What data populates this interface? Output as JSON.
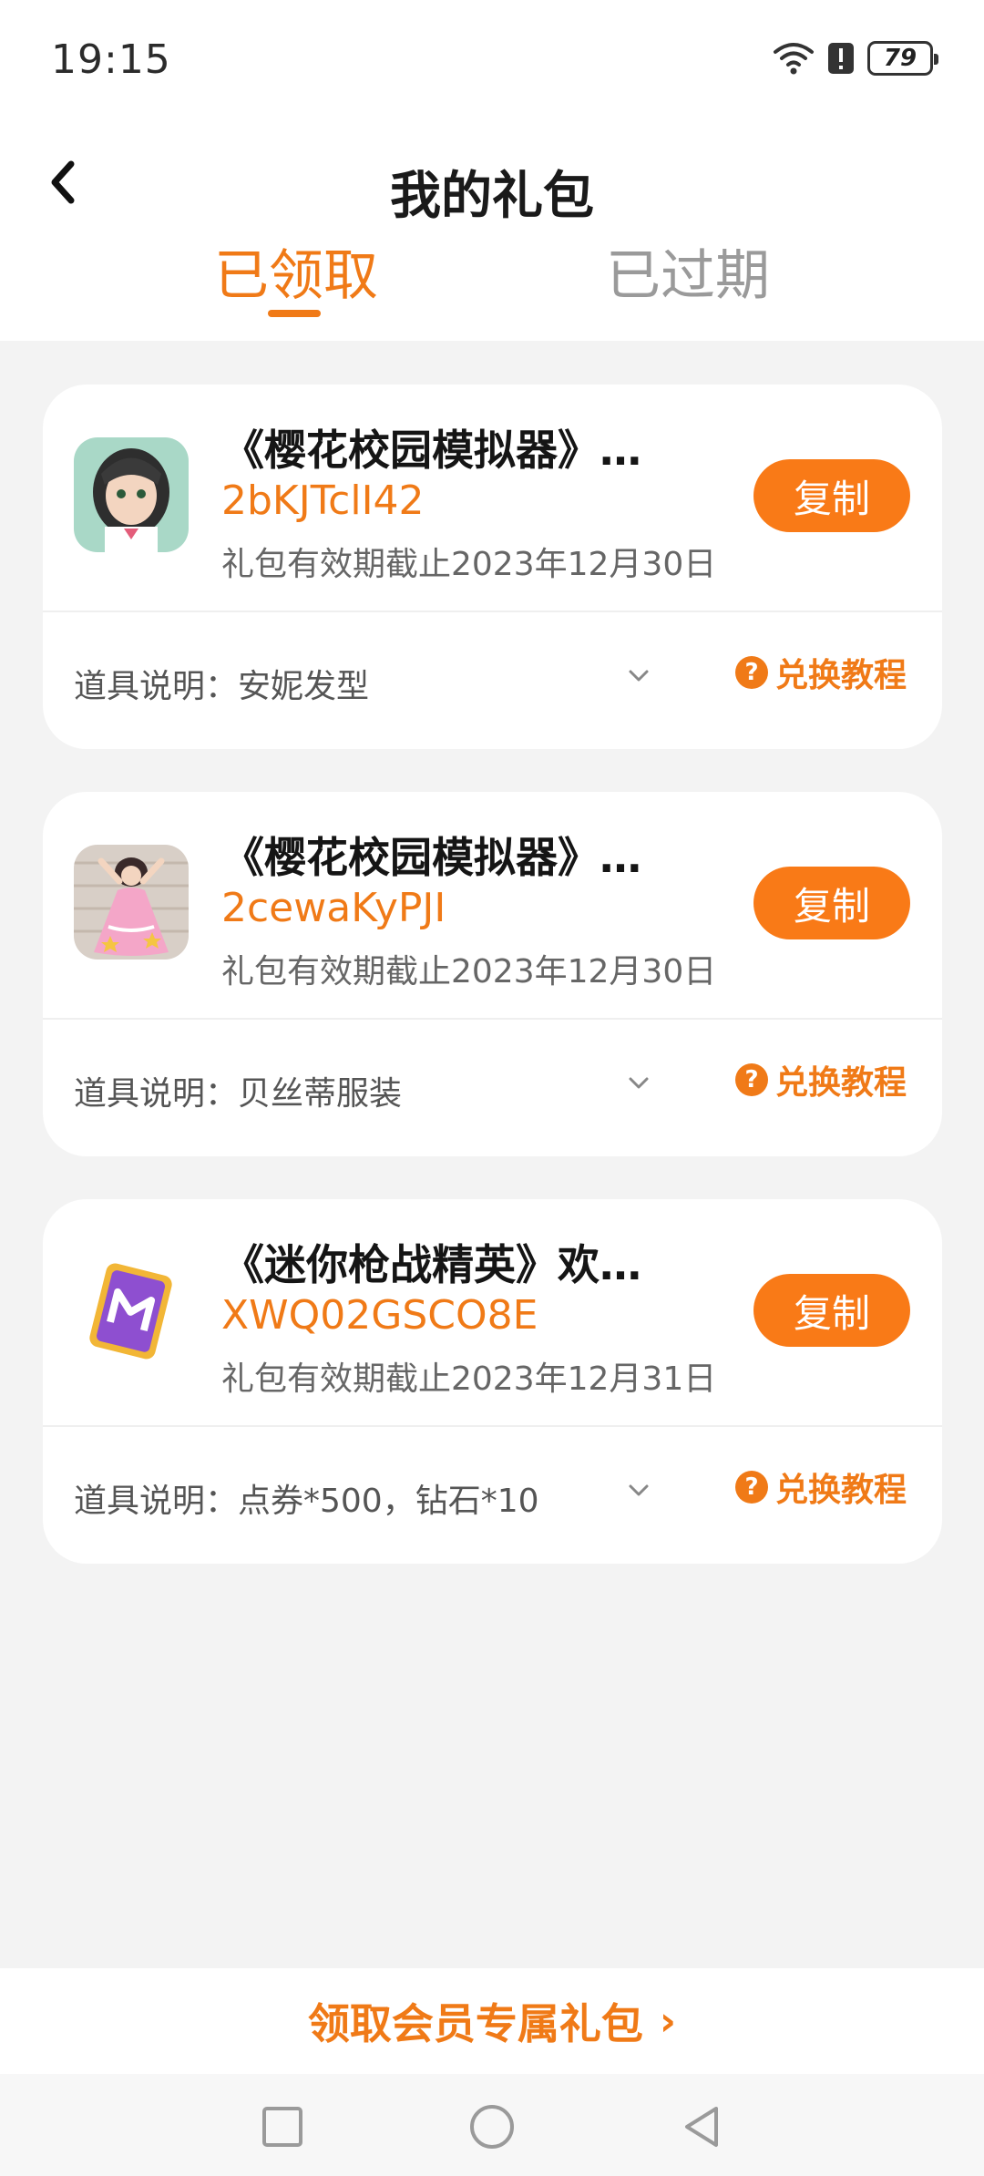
{
  "status": {
    "time": "19:15",
    "battery": "79"
  },
  "header": {
    "title": "我的礼包",
    "tabs": [
      {
        "label": "已领取",
        "active": true
      },
      {
        "label": "已过期",
        "active": false
      }
    ]
  },
  "gifts": [
    {
      "title": "《樱花校园模拟器》…",
      "code": "2bKJTclI42",
      "expiry": "礼包有效期截止2023年12月30日",
      "copy_label": "复制",
      "description": "道具说明：安妮发型",
      "tutorial_label": "兑换教程",
      "icon": "sakura-girl-icon"
    },
    {
      "title": "《樱花校园模拟器》…",
      "code": "2cewaKyPJI",
      "expiry": "礼包有效期截止2023年12月30日",
      "copy_label": "复制",
      "description": "道具说明：贝丝蒂服装",
      "tutorial_label": "兑换教程",
      "icon": "pink-dress-icon"
    },
    {
      "title": "《迷你枪战精英》欢…",
      "code": "XWQ02GSCO8E",
      "expiry": "礼包有效期截止2023年12月31日",
      "copy_label": "复制",
      "description": "道具说明：点券*500，钻石*10",
      "tutorial_label": "兑换教程",
      "icon": "mini-card-icon"
    }
  ],
  "footer": {
    "member_link": "领取会员专属礼包"
  },
  "colors": {
    "accent": "#f07a17",
    "background": "#f3f3f3",
    "card": "#ffffff"
  }
}
